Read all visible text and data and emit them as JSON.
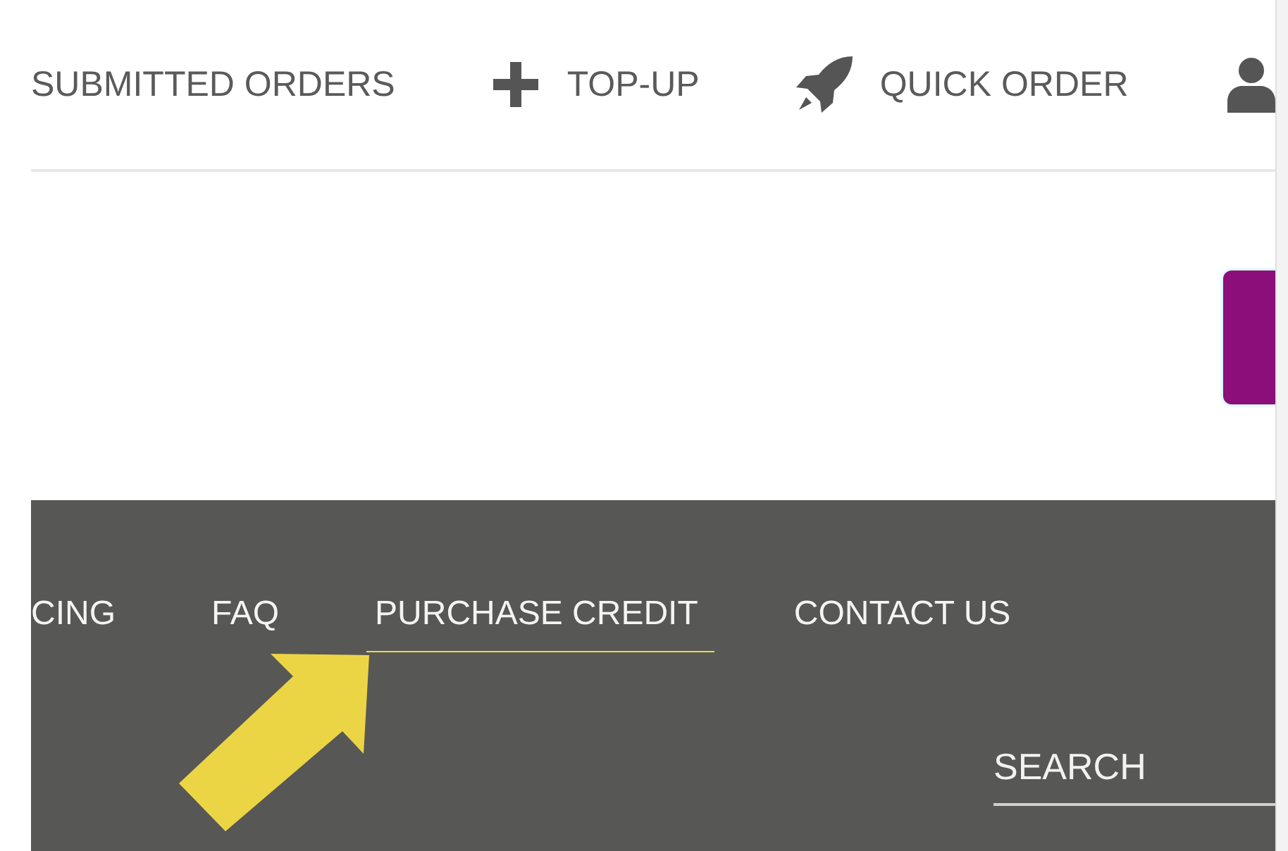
{
  "header": {
    "submitted_orders": {
      "label": "SUBMITTED ORDERS"
    },
    "top_up": {
      "label": "TOP-UP"
    },
    "quick_order": {
      "label": "QUICK ORDER"
    }
  },
  "footer_nav": [
    {
      "label": "CING",
      "selected": false
    },
    {
      "label": "FAQ",
      "selected": false
    },
    {
      "label": "PURCHASE CREDIT",
      "selected": true
    },
    {
      "label": "CONTACT US",
      "selected": false
    }
  ],
  "search": {
    "placeholder": "SEARCH"
  }
}
